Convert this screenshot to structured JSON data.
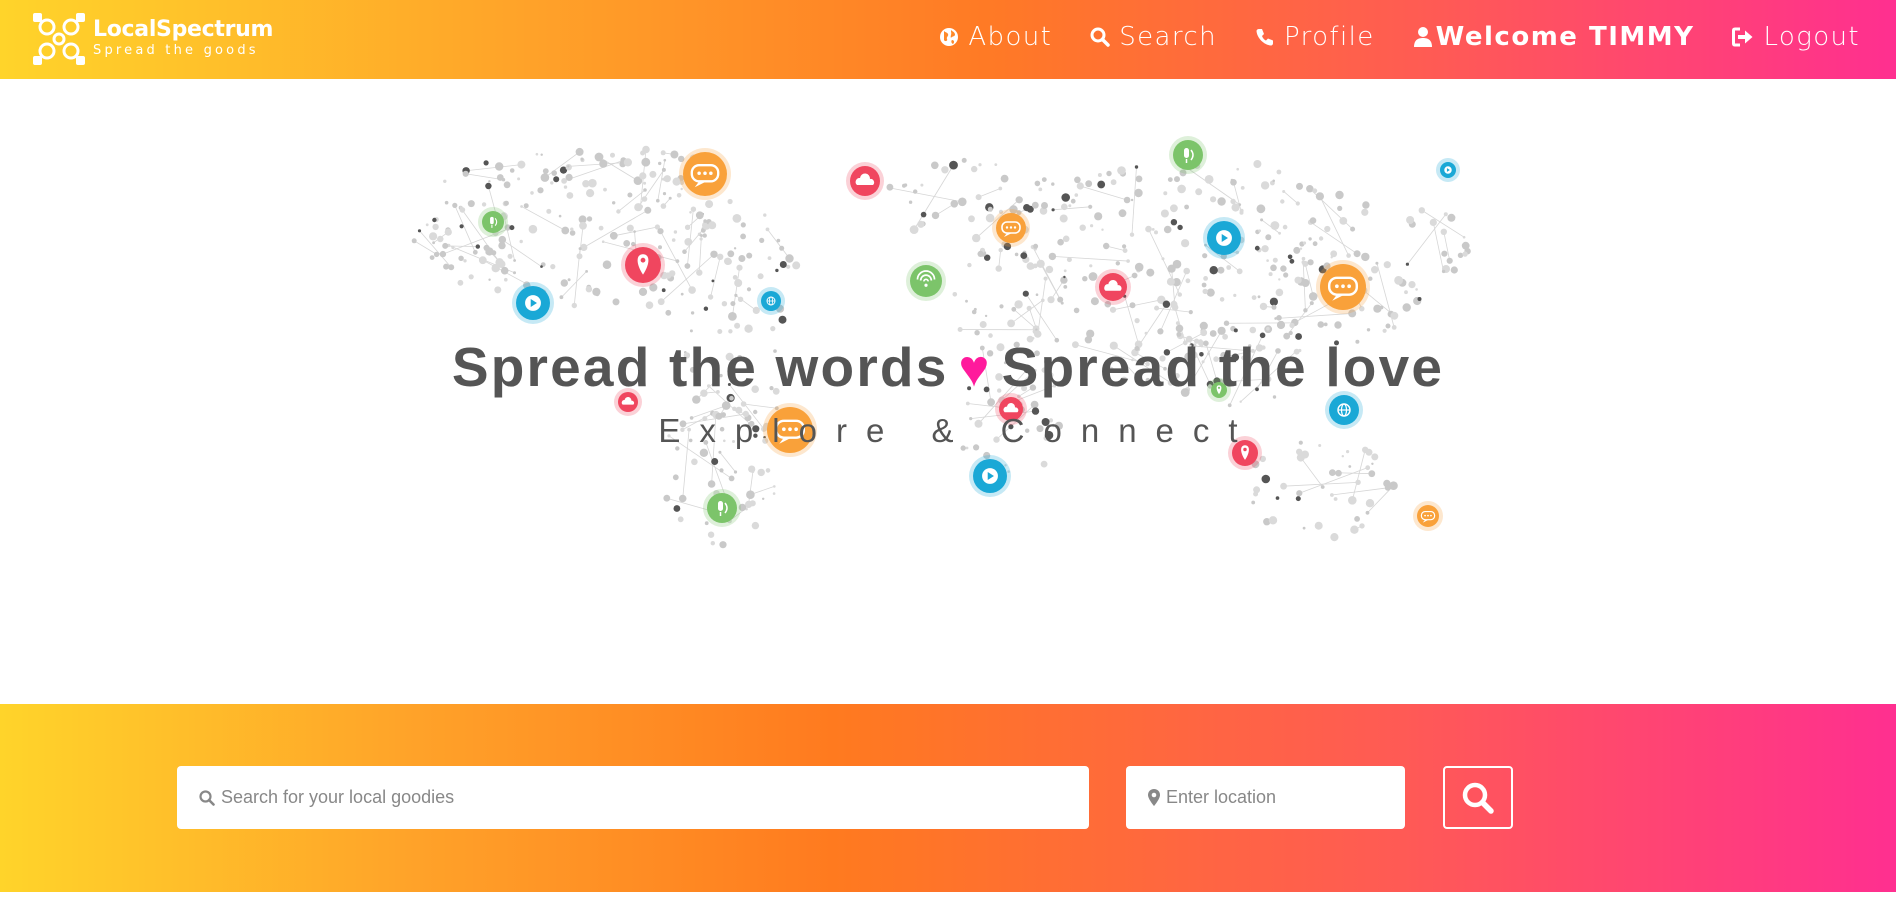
{
  "brand": {
    "name": "LocalSpectrum",
    "tagline": "Spread the goods"
  },
  "nav": {
    "about": "About",
    "search": "Search",
    "profile": "Profile",
    "welcome": "Welcome TIMMY",
    "logout": "Logout"
  },
  "hero": {
    "title_left": "Spread the words",
    "heart": "♥",
    "title_right": "Spread the love",
    "subtitle": "Explore & Connect"
  },
  "search": {
    "query_placeholder": "Search for your local goodies",
    "location_placeholder": "Enter location"
  },
  "colors": {
    "orange": "#f9a13a",
    "red": "#f0465f",
    "blue": "#1aa8d6",
    "green": "#7cc46a",
    "heart": "#ff1a9c",
    "text": "#555555"
  },
  "map_icons": [
    "chat-icon",
    "cloud-icon",
    "pin-icon",
    "play-icon",
    "globe-icon",
    "wifi-icon",
    "mic-icon"
  ]
}
